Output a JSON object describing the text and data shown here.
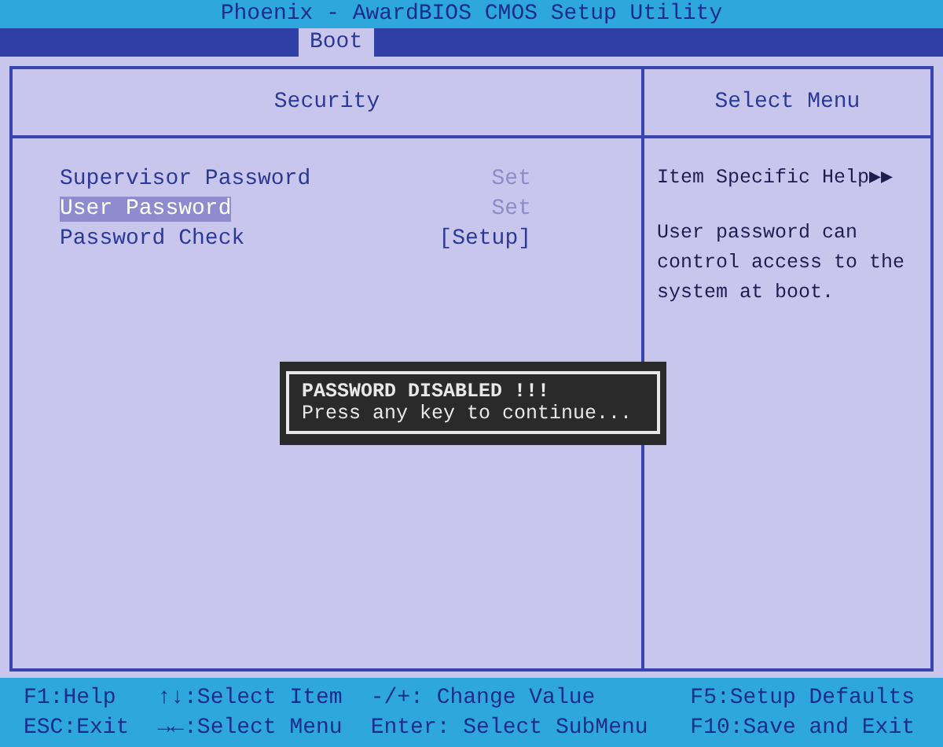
{
  "window": {
    "title": "Phoenix - AwardBIOS CMOS Setup Utility"
  },
  "tabs": [
    {
      "label": "Boot",
      "selected": true
    }
  ],
  "main": {
    "heading": "Security",
    "items": [
      {
        "label": "Supervisor Password",
        "value": "Set",
        "selected": false,
        "readonly": true
      },
      {
        "label": "User Password",
        "value": "Set",
        "selected": true,
        "readonly": true
      },
      {
        "label": "Password Check",
        "value": "[Setup]",
        "selected": false,
        "readonly": false
      }
    ]
  },
  "help": {
    "heading": "Select Menu",
    "title": "Item Specific Help▶▶",
    "text": "User password can control access to the system at boot."
  },
  "dialog": {
    "title": "PASSWORD DISABLED !!!",
    "message": "Press any key to continue..."
  },
  "footer": [
    [
      "F1:Help",
      "ESC:Exit"
    ],
    [
      "↑↓:Select Item",
      "→←:Select Menu"
    ],
    [
      "-/+: Change Value",
      "Enter: Select SubMenu"
    ],
    [
      "F5:Setup Defaults",
      "F10:Save and Exit"
    ]
  ]
}
